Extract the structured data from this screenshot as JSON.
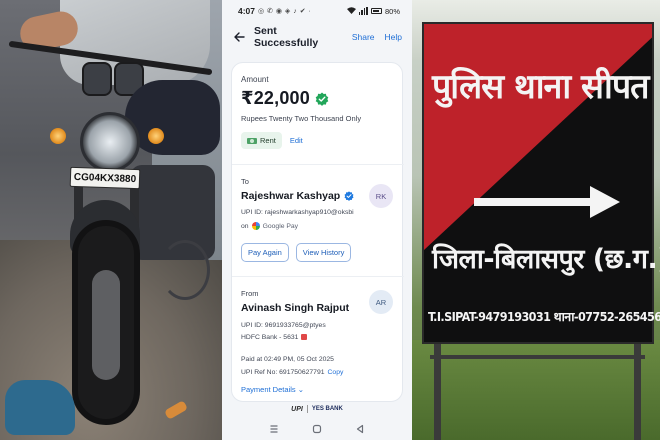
{
  "left_photo": {
    "plate_text": "CG04KX3880"
  },
  "status_bar": {
    "time": "4:07",
    "battery": "80%"
  },
  "header": {
    "title": "Sent Successfully",
    "share_label": "Share",
    "help_label": "Help"
  },
  "amount": {
    "label": "Amount",
    "value": "₹22,000",
    "in_words": "Rupees Twenty Two Thousand Only",
    "note": "Rent",
    "edit_label": "Edit"
  },
  "recipient": {
    "label": "To",
    "name": "Rajeshwar Kashyap",
    "avatar_initials": "RK",
    "upi_id": "UPI ID: rajeshwarkashyap910@oksbi",
    "via_prefix": "on",
    "via_app": "Google Pay",
    "pay_again_label": "Pay Again",
    "view_history_label": "View History"
  },
  "sender": {
    "label": "From",
    "name": "Avinash Singh Rajput",
    "avatar_initials": "AR",
    "upi_id": "UPI ID: 9691933765@ptyes",
    "bank": "HDFC Bank - 5631"
  },
  "transaction": {
    "paid_at": "Paid at 02:49 PM, 05 Oct 2025",
    "ref_no": "UPI Ref No: 691750627791",
    "copy_label": "Copy",
    "details_label": "Payment Details"
  },
  "footer": {
    "upi": "UPI",
    "bank": "YES BANK"
  },
  "sign": {
    "title": "पुलिस थाना सीपत",
    "district": "जिला-बिलासपुर (छ.ग.)",
    "contact": "T.I.SIPAT-9479193031 थाना-07752-265456"
  },
  "colors": {
    "accent": "#1f6fd6",
    "verified_green": "#22a65a",
    "sign_red": "#c8242c"
  }
}
